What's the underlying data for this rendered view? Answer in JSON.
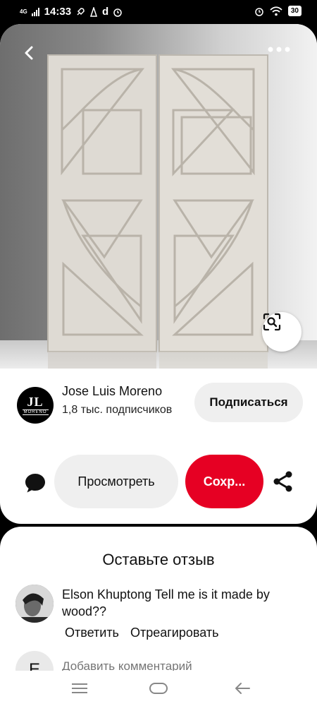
{
  "status_bar": {
    "network": "4G",
    "time": "14:33",
    "notification_letter": "d",
    "battery": "30"
  },
  "pin": {
    "icons": {
      "back": "back-arrow-icon",
      "more": "more-options-icon",
      "lens": "visual-search-icon"
    }
  },
  "creator": {
    "logo_initials": "JL",
    "logo_word": "MORENO",
    "name": "Jose Luis Moreno",
    "followers": "1,8 тыс. подписчиков",
    "subscribe_label": "Подписаться"
  },
  "actions": {
    "view_label": "Просмотреть",
    "save_label": "Сохр...",
    "accent_color": "#e60023"
  },
  "comments": {
    "title": "Оставьте отзыв",
    "items": [
      {
        "author": "Elson Khuptong",
        "text": "Tell me is it made by wood??",
        "reply_label": "Ответить",
        "react_label": "Отреагировать"
      }
    ],
    "input_initial": "Е",
    "input_placeholder": "Добавить комментарий"
  }
}
